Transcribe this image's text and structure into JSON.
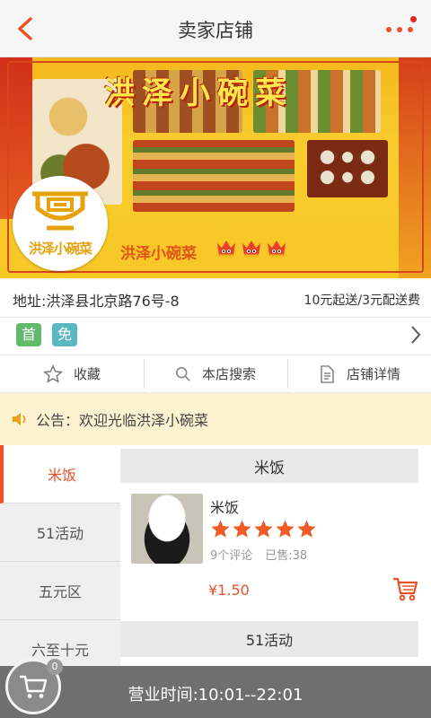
{
  "header": {
    "title": "卖家店铺"
  },
  "banner": {
    "headline": "洪泽小碗菜"
  },
  "shop": {
    "logo_text": "洪泽小碗菜",
    "name": "洪泽小碗菜",
    "rating_crowns": 3,
    "address": "地址:洪泽县北京路76号-8",
    "fees": "10元起送/3元配送费"
  },
  "tags": {
    "first": "首",
    "free": "免"
  },
  "actions": {
    "favorite": "收藏",
    "search": "本店搜索",
    "details": "店铺详情"
  },
  "notice": {
    "text": "公告：欢迎光临洪泽小碗菜"
  },
  "categories": [
    "米饭",
    "51活动",
    "五元区",
    "六至十元"
  ],
  "section": {
    "title": "米饭",
    "next_title": "51活动"
  },
  "item": {
    "name": "米饭",
    "stars": 5,
    "reviews": "9个评论",
    "sold": "已售:38",
    "price": "¥1.50"
  },
  "cart": {
    "count": "0",
    "hours": "营业时间:10:01--22:01"
  },
  "colors": {
    "accent": "#e8512a",
    "notice_bg": "#fbf3cf",
    "bottom_bar": "#6f6f6f"
  }
}
